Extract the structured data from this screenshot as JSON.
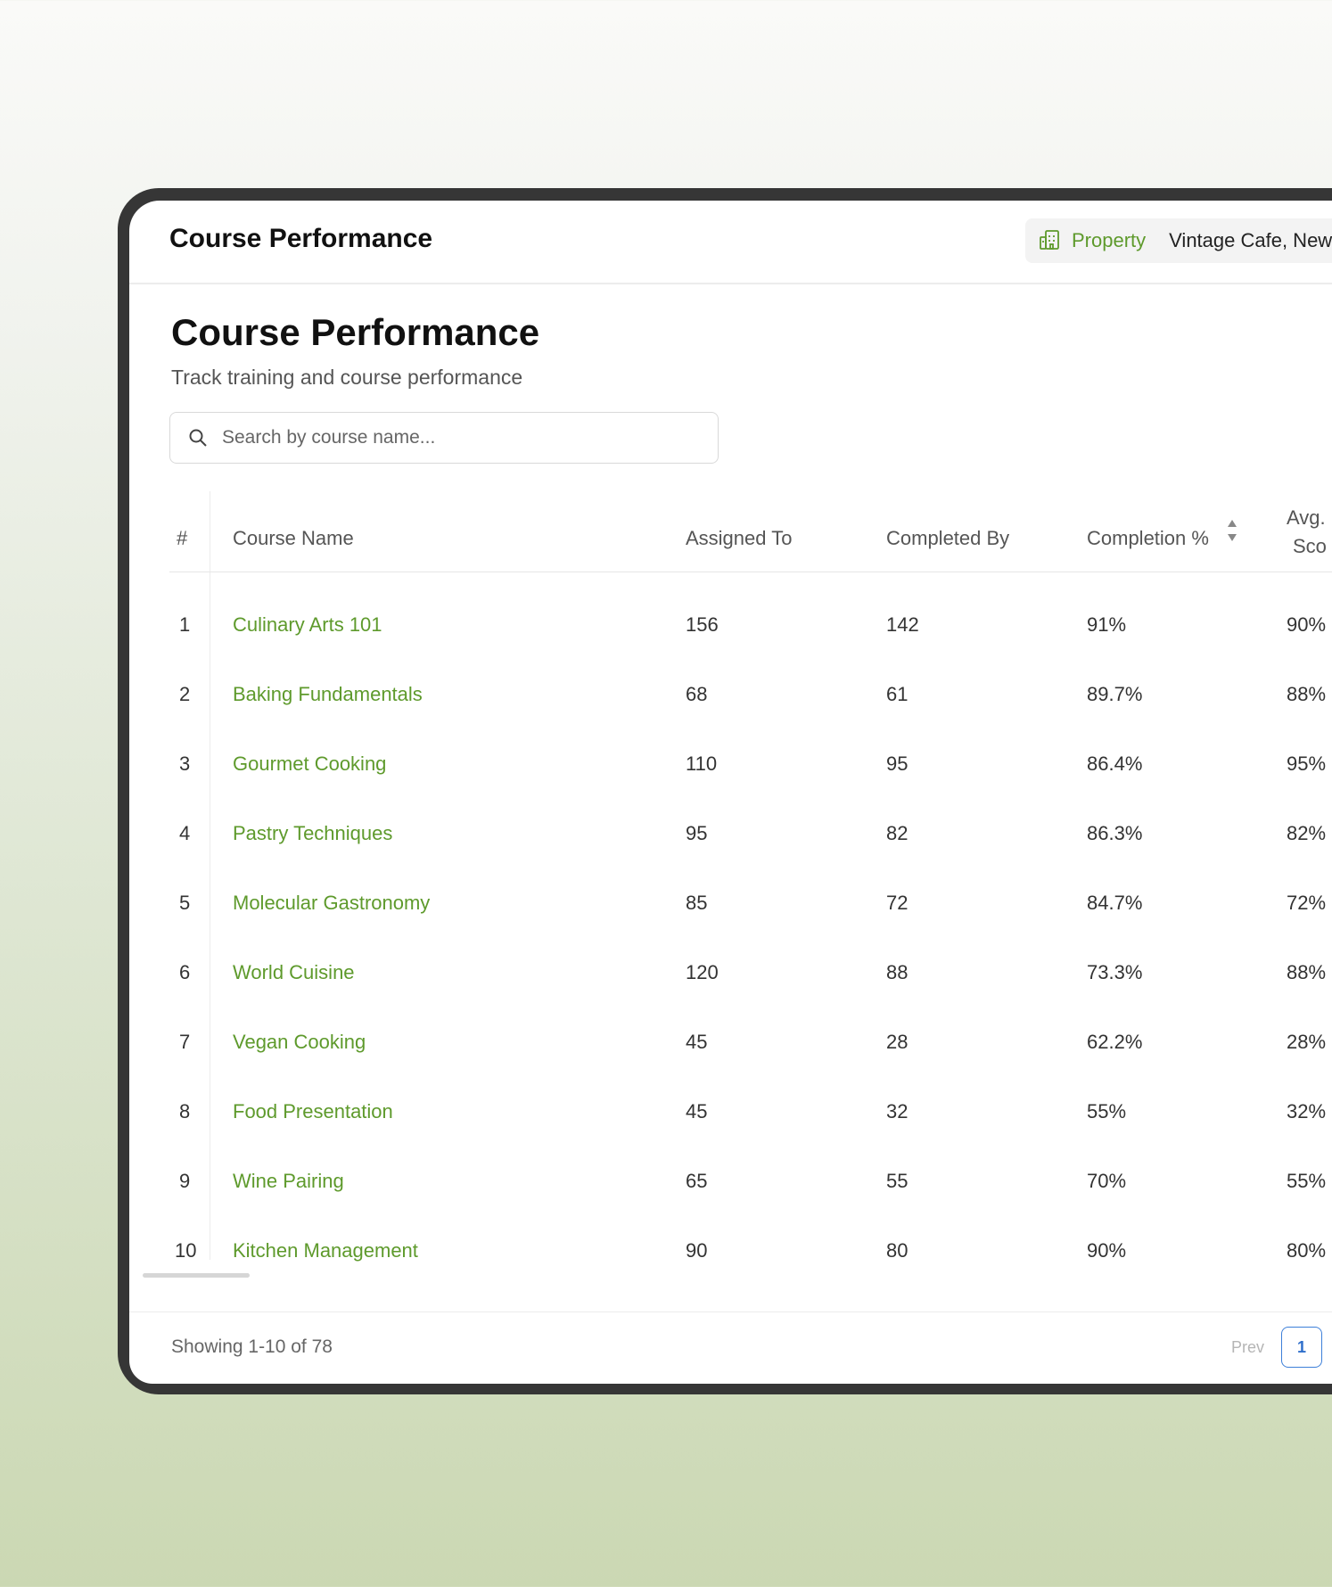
{
  "topbar": {
    "title": "Course Performance",
    "property_label": "Property",
    "property_value": "Vintage Cafe, New"
  },
  "page": {
    "title": "Course Performance",
    "subtitle": "Track training and course performance"
  },
  "search": {
    "placeholder": "Search by course name..."
  },
  "table": {
    "headers": {
      "index": "#",
      "name": "Course Name",
      "assigned": "Assigned To",
      "completed": "Completed By",
      "completion": "Completion %",
      "avg_line1": "Avg.",
      "avg_line2": "Sco"
    },
    "rows": [
      {
        "index": "1",
        "name": "Culinary Arts 101",
        "assigned": "156",
        "completed": "142",
        "completion": "91%",
        "avg": "90%"
      },
      {
        "index": "2",
        "name": "Baking Fundamentals",
        "assigned": "68",
        "completed": "61",
        "completion": "89.7%",
        "avg": "88%"
      },
      {
        "index": "3",
        "name": "Gourmet Cooking",
        "assigned": "110",
        "completed": "95",
        "completion": "86.4%",
        "avg": "95%"
      },
      {
        "index": "4",
        "name": "Pastry Techniques",
        "assigned": "95",
        "completed": "82",
        "completion": "86.3%",
        "avg": "82%"
      },
      {
        "index": "5",
        "name": "Molecular Gastronomy",
        "assigned": "85",
        "completed": "72",
        "completion": "84.7%",
        "avg": "72%"
      },
      {
        "index": "6",
        "name": "World Cuisine",
        "assigned": "120",
        "completed": "88",
        "completion": "73.3%",
        "avg": "88%"
      },
      {
        "index": "7",
        "name": "Vegan Cooking",
        "assigned": "45",
        "completed": "28",
        "completion": "62.2%",
        "avg": "28%"
      },
      {
        "index": "8",
        "name": "Food Presentation",
        "assigned": "45",
        "completed": "32",
        "completion": "55%",
        "avg": "32%"
      },
      {
        "index": "9",
        "name": "Wine Pairing",
        "assigned": "65",
        "completed": "55",
        "completion": "70%",
        "avg": "55%"
      },
      {
        "index": "10",
        "name": "Kitchen Management",
        "assigned": "90",
        "completed": "80",
        "completion": "90%",
        "avg": "80%"
      }
    ]
  },
  "footer": {
    "showing": "Showing 1-10 of 78",
    "prev": "Prev",
    "current_page": "1"
  },
  "colors": {
    "accent": "#5e9a2c",
    "pagination": "#3d7fd9"
  }
}
